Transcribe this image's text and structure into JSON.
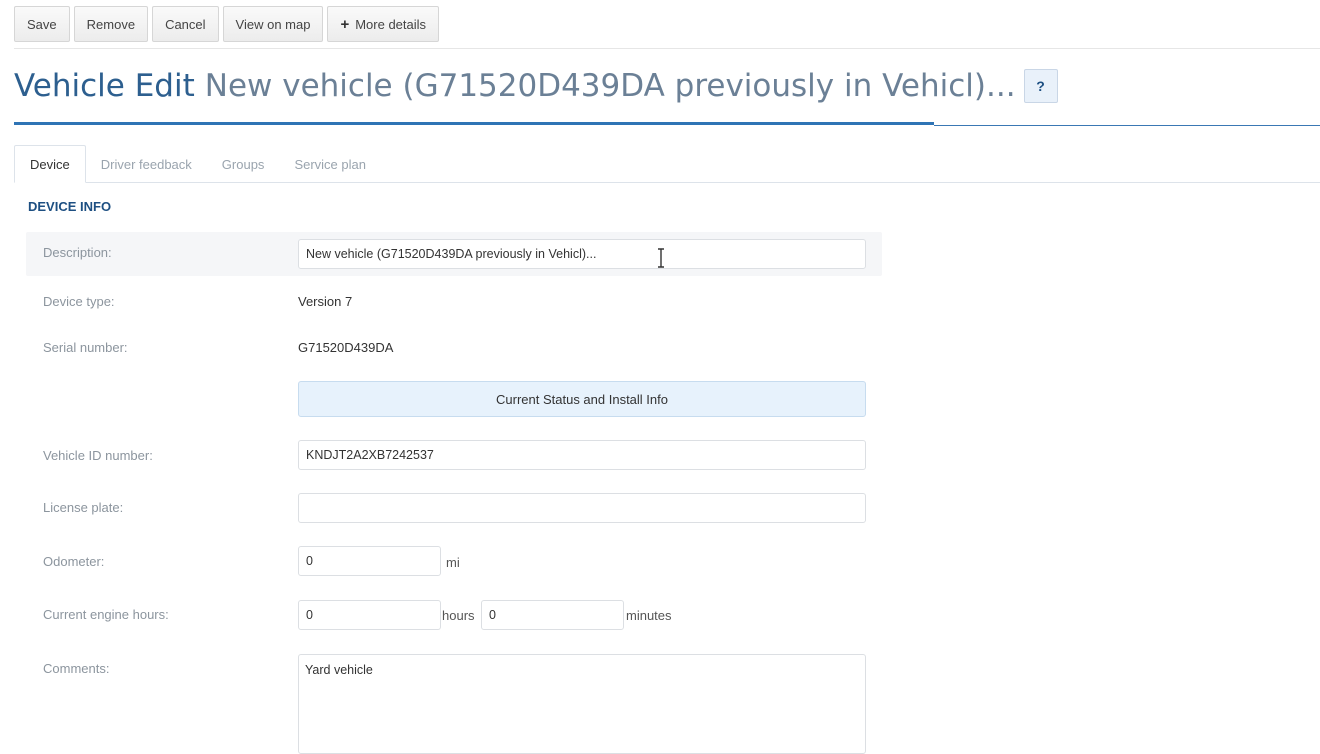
{
  "toolbar": {
    "save": "Save",
    "remove": "Remove",
    "cancel": "Cancel",
    "view_on_map": "View on map",
    "more_details_icon": "+",
    "more_details": "More details"
  },
  "header": {
    "title": "Vehicle Edit",
    "subtitle": "New vehicle (G71520D439DA previously in Vehicl)...",
    "help": "?"
  },
  "tabs": [
    {
      "label": "Device",
      "active": true
    },
    {
      "label": "Driver feedback",
      "active": false
    },
    {
      "label": "Groups",
      "active": false
    },
    {
      "label": "Service plan",
      "active": false
    }
  ],
  "device_info": {
    "section_title": "DEVICE INFO",
    "description_label": "Description:",
    "description_value": "New vehicle (G71520D439DA previously in Vehicl)...",
    "device_type_label": "Device type:",
    "device_type_value": "Version 7",
    "serial_label": "Serial number:",
    "serial_value": "G71520D439DA",
    "status_button": "Current Status and Install Info",
    "vin_label": "Vehicle ID number:",
    "vin_value": "KNDJT2A2XB7242537",
    "plate_label": "License plate:",
    "plate_value": "",
    "odometer_label": "Odometer:",
    "odometer_value": "0",
    "odometer_unit": "mi",
    "engine_hours_label": "Current engine hours:",
    "engine_hours_value": "0",
    "hours_unit": "hours",
    "engine_minutes_value": "0",
    "minutes_unit": "minutes",
    "comments_label": "Comments:",
    "comments_value": "Yard vehicle"
  },
  "colors": {
    "accent": "#2f74b5",
    "title": "#2d5f8f",
    "section_title": "#1d4f82"
  }
}
